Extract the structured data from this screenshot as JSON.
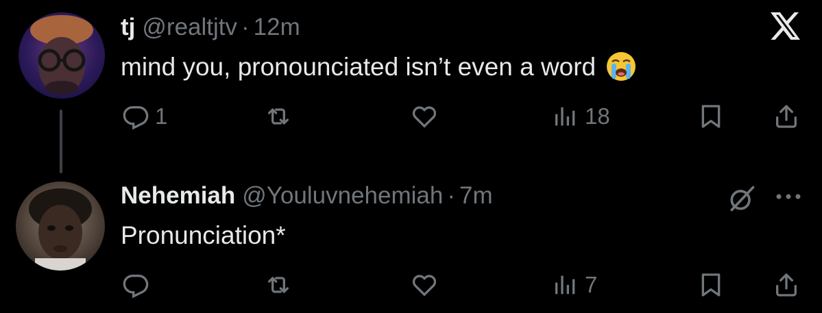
{
  "tweets": [
    {
      "name": "tj",
      "handle": "@realtjtv",
      "separator": "·",
      "time": "12m",
      "text": "mind you, pronounciated isn’t even a word",
      "emoji": "loudly-crying-face",
      "replies": "1",
      "reposts": "",
      "likes": "",
      "views": "18"
    },
    {
      "name": "Nehemiah",
      "handle": "@Youluvnehemiah",
      "separator": "·",
      "time": "7m",
      "text": "Pronunciation*",
      "replies": "",
      "reposts": "",
      "likes": "",
      "views": "7"
    }
  ],
  "icons": {
    "reply": "reply-icon",
    "repost": "repost-icon",
    "like": "heart-icon",
    "views": "views-icon",
    "bookmark": "bookmark-icon",
    "share": "share-icon",
    "brand": "x-logo-icon",
    "grok": "grok-icon",
    "more": "more-icon"
  },
  "colors": {
    "background": "#000000",
    "text": "#e7e9ea",
    "muted": "#71767b",
    "thread_line": "#3e4144"
  }
}
